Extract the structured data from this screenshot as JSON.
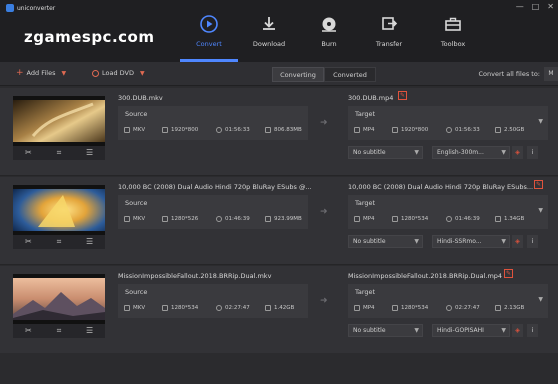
{
  "app": {
    "title": "uniconverter",
    "watermark": "zgamespc.com"
  },
  "window_controls": [
    "—",
    "□",
    "✕"
  ],
  "nav": [
    {
      "label": "Convert",
      "icon": "convert-icon",
      "active": true
    },
    {
      "label": "Download",
      "icon": "download-icon",
      "active": false
    },
    {
      "label": "Burn",
      "icon": "burn-icon",
      "active": false
    },
    {
      "label": "Transfer",
      "icon": "transfer-icon",
      "active": false
    },
    {
      "label": "Toolbox",
      "icon": "toolbox-icon",
      "active": false
    }
  ],
  "toolbar": {
    "add_files": "Add Files",
    "load_dvd": "Load DVD",
    "tab_converting": "Converting",
    "tab_converted": "Converted",
    "convert_all_label": "Convert all files to:",
    "convert_all_value": "M"
  },
  "colors": {
    "accent": "#4f87ff",
    "red": "#e0533d",
    "bg": "#2b2b2e"
  },
  "files": [
    {
      "source_name": "300.DUB.mkv",
      "source_label": "Source",
      "source": {
        "format": "MKV",
        "resolution": "1920*800",
        "duration": "01:56:33",
        "size": "806.83MB"
      },
      "target_name": "300.DUB.mp4",
      "target_label": "Target",
      "target": {
        "format": "MP4",
        "resolution": "1920*800",
        "duration": "01:56:33",
        "size": "2.50GB"
      },
      "subtitle": "No subtitle",
      "audio": "English-300m..."
    },
    {
      "source_name": "10,000 BC (2008) Dual Audio Hindi 720p BluRay ESubs @...",
      "source_label": "Source",
      "source": {
        "format": "MKV",
        "resolution": "1280*526",
        "duration": "01:46:39",
        "size": "923.99MB"
      },
      "target_name": "10,000 BC (2008) Dual Audio Hindi 720p BluRay ESubs...",
      "target_label": "Target",
      "target": {
        "format": "MP4",
        "resolution": "1280*534",
        "duration": "01:46:39",
        "size": "1.34GB"
      },
      "subtitle": "No subtitle",
      "audio": "Hindi-SSRmo..."
    },
    {
      "source_name": "MissionImpossibleFallout.2018.BRRip.Dual.mkv",
      "source_label": "Source",
      "source": {
        "format": "MKV",
        "resolution": "1280*534",
        "duration": "02:27:47",
        "size": "1.42GB"
      },
      "target_name": "MissionImpossibleFallout.2018.BRRip.Dual.mp4",
      "target_label": "Target",
      "target": {
        "format": "MP4",
        "resolution": "1280*534",
        "duration": "02:27:47",
        "size": "2.13GB"
      },
      "subtitle": "No subtitle",
      "audio": "Hindi-GOPISAHI"
    }
  ]
}
